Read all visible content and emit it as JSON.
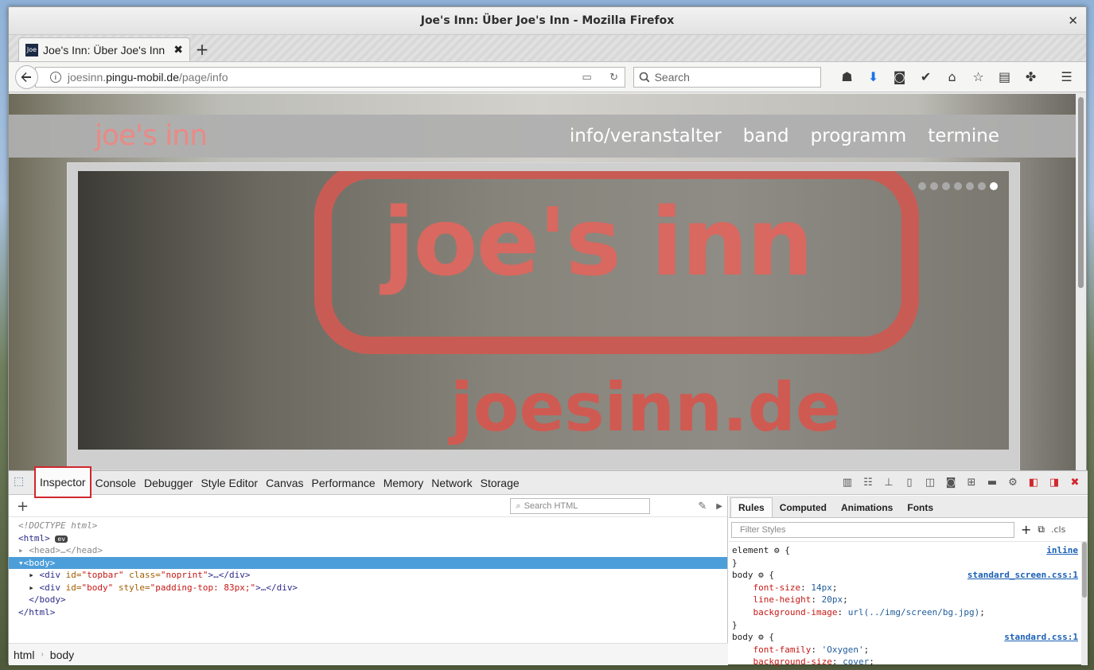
{
  "window": {
    "title": "Joe's Inn: Über Joe's Inn - Mozilla Firefox",
    "close_glyph": "✕"
  },
  "tab": {
    "favicon_text": "Joe",
    "label": "Joe's Inn: Über Joe's Inn",
    "close_glyph": "✖",
    "new_tab_glyph": "+"
  },
  "navbar": {
    "url_prefix": "joesinn.",
    "url_domain": "pingu-mobil.de",
    "url_path": "/page/info",
    "search_placeholder": "Search"
  },
  "site": {
    "logo": "joe's inn",
    "nav": [
      "info/veranstalter",
      "band",
      "programm",
      "termine"
    ],
    "slide_title": "joe's inn",
    "slide_sub": "joesinn.de",
    "dots_count": 7,
    "active_dot_index": 6
  },
  "devtools": {
    "tabs": [
      "Inspector",
      "Console",
      "Debugger",
      "Style Editor",
      "Canvas",
      "Performance",
      "Memory",
      "Network",
      "Storage"
    ],
    "selected_tab": "Inspector",
    "search_html_placeholder": "Search HTML",
    "tree": {
      "doctype": "<!DOCTYPE html>",
      "html_open": "<html>",
      "ev_badge": "ev",
      "head": "<head>…</head>",
      "body_open": "<body>",
      "div1_tag": "<div",
      "div1_a1": "id=",
      "div1_v1": "\"topbar\"",
      "div1_a2": "class=",
      "div1_v2": "\"noprint\"",
      "div1_end": ">…</div>",
      "div2_tag": "<div",
      "div2_a1": "id=",
      "div2_v1": "\"body\"",
      "div2_a2": "style=",
      "div2_v2": "\"padding-top: 83px;\"",
      "div2_end": ">…</div>",
      "body_close": "</body>",
      "html_close": "</html>"
    },
    "breadcrumbs": [
      "html",
      "body"
    ],
    "rules_tabs": [
      "Rules",
      "Computed",
      "Animations",
      "Fonts"
    ],
    "filter_placeholder": "Filter Styles",
    "cls_label": ".cls",
    "rules": {
      "r1_selector": "element",
      "r1_source": "inline",
      "r2_selector": "body",
      "r2_source": "standard_screen.css:1",
      "r2_p1_name": "font-size",
      "r2_p1_val": "14px",
      "r2_p2_name": "line-height",
      "r2_p2_val": "20px",
      "r2_p3_name": "background-image",
      "r2_p3_val": "url(../img/screen/bg.jpg)",
      "r3_selector": "body",
      "r3_source": "standard.css:1",
      "r3_p1_name": "font-family",
      "r3_p1_val": "'Oxygen'",
      "r3_p2_name": "background-size",
      "r3_p2_val": "cover"
    }
  },
  "colors": {
    "accent": "#d0272e",
    "selection": "#4c9ed9",
    "logo": "#e98a86"
  }
}
